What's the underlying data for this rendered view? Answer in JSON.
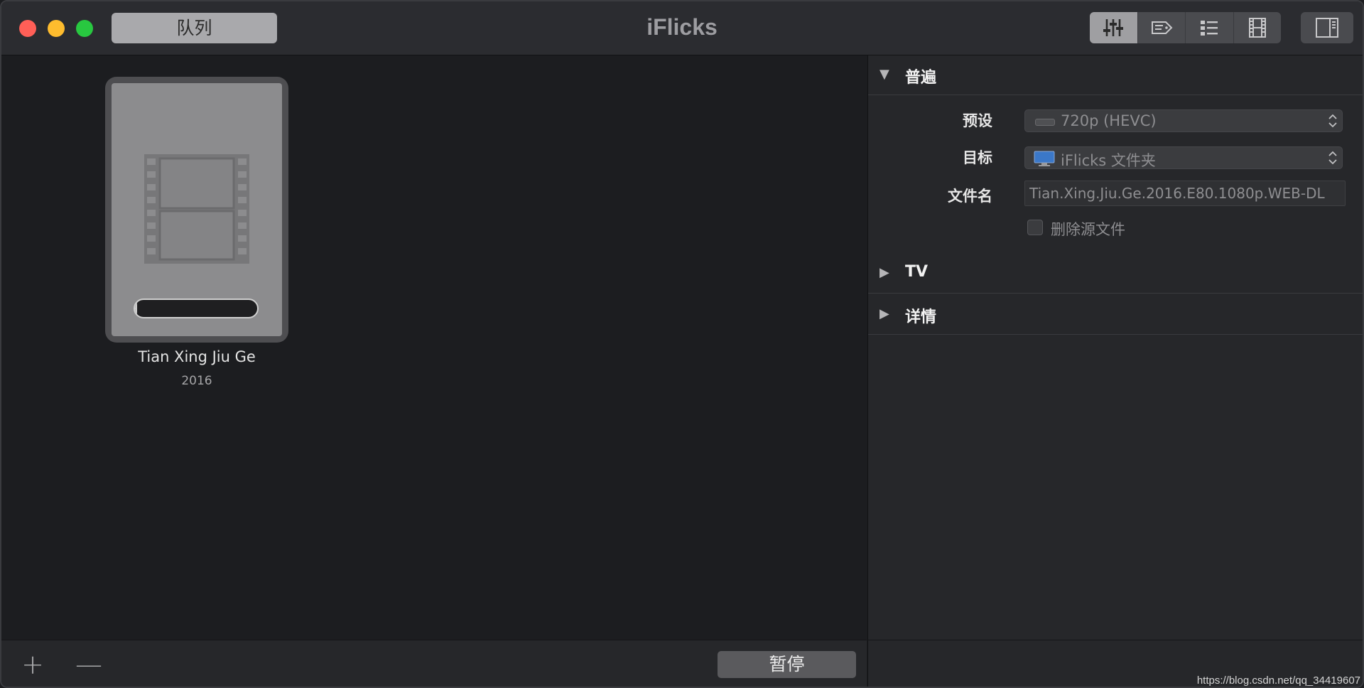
{
  "window": {
    "title": "iFlicks",
    "queue_button": "队列"
  },
  "toolbar": {
    "segments": [
      "sliders-icon",
      "tag-icon",
      "list-icon",
      "film-strip-icon"
    ],
    "active_segment": "sliders-icon",
    "sidebar_toggle": "sidebar-icon"
  },
  "queue": {
    "items": [
      {
        "title": "Tian Xing Jiu Ge",
        "year": "2016",
        "progress": 0.02
      }
    ],
    "add_label": "+",
    "remove_label": "—",
    "pause_label": "暂停"
  },
  "inspector": {
    "sections": {
      "general": "普遍",
      "tv": "TV",
      "details": "详情"
    },
    "preset": {
      "label": "预设",
      "value": "720p (HEVC)"
    },
    "target": {
      "label": "目标",
      "value": "iFlicks 文件夹"
    },
    "filename": {
      "label": "文件名",
      "value": "Tian.Xing.Jiu.Ge.2016.E80.1080p.WEB-DL"
    },
    "delete_source": {
      "label": "删除源文件",
      "checked": false
    }
  },
  "watermark": "https://blog.csdn.net/qq_34419607",
  "colors": {
    "close": "#ff5f57",
    "minimize": "#febc2e",
    "maximize": "#28c840"
  }
}
